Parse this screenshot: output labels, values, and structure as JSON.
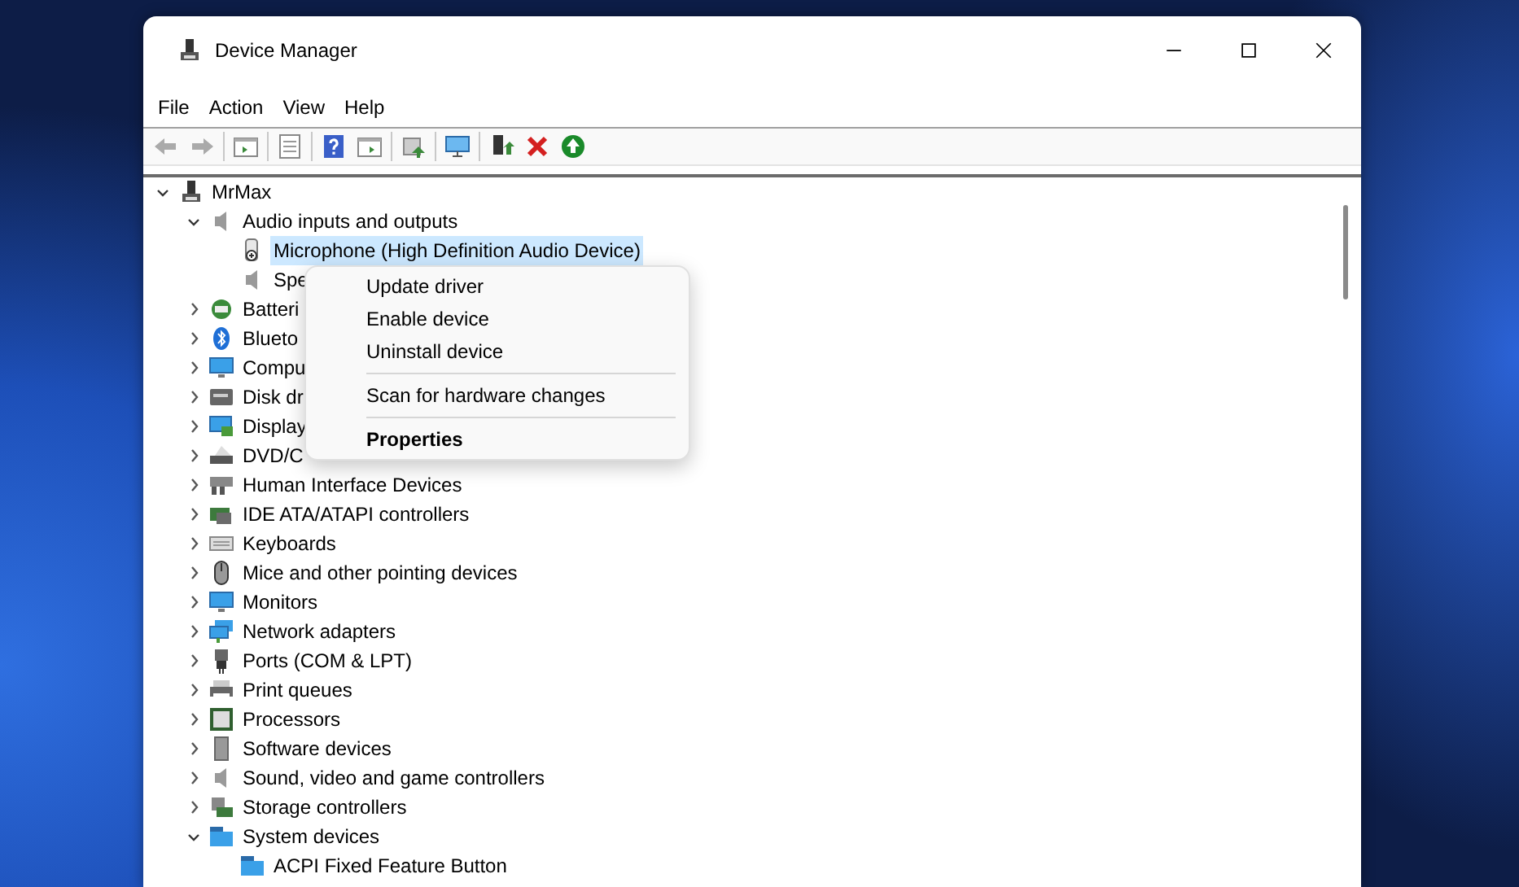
{
  "window": {
    "title": "Device Manager"
  },
  "menu_bar": [
    "File",
    "Action",
    "View",
    "Help"
  ],
  "tree": [
    {
      "label": "MrMax",
      "expanded": true,
      "selected": false,
      "children": [
        {
          "label": "Audio inputs and outputs",
          "expanded": true,
          "selected": false,
          "children": [
            {
              "label": "Microphone (High Definition Audio Device)",
              "selected": true
            },
            {
              "label": "Spe",
              "selected": false
            }
          ]
        },
        {
          "label": "Batteri",
          "expanded": false,
          "selected": false
        },
        {
          "label": "Blueto",
          "expanded": false,
          "selected": false
        },
        {
          "label": "Compu",
          "expanded": false,
          "selected": false
        },
        {
          "label": "Disk dr",
          "expanded": false,
          "selected": false
        },
        {
          "label": "Display",
          "expanded": false,
          "selected": false
        },
        {
          "label": "DVD/C",
          "expanded": false,
          "selected": false
        },
        {
          "label": "Human Interface Devices",
          "expanded": false,
          "selected": false
        },
        {
          "label": "IDE ATA/ATAPI controllers",
          "expanded": false,
          "selected": false
        },
        {
          "label": "Keyboards",
          "expanded": false,
          "selected": false
        },
        {
          "label": "Mice and other pointing devices",
          "expanded": false,
          "selected": false
        },
        {
          "label": "Monitors",
          "expanded": false,
          "selected": false
        },
        {
          "label": "Network adapters",
          "expanded": false,
          "selected": false
        },
        {
          "label": "Ports (COM & LPT)",
          "expanded": false,
          "selected": false
        },
        {
          "label": "Print queues",
          "expanded": false,
          "selected": false
        },
        {
          "label": "Processors",
          "expanded": false,
          "selected": false
        },
        {
          "label": "Software devices",
          "expanded": false,
          "selected": false
        },
        {
          "label": "Sound, video and game controllers",
          "expanded": false,
          "selected": false
        },
        {
          "label": "Storage controllers",
          "expanded": false,
          "selected": false
        },
        {
          "label": "System devices",
          "expanded": true,
          "selected": false,
          "children": [
            {
              "label": "ACPI Fixed Feature Button",
              "selected": false
            }
          ]
        }
      ]
    }
  ],
  "context_menu": [
    {
      "kind": "item",
      "label": "Update driver",
      "default": false
    },
    {
      "kind": "item",
      "label": "Enable device",
      "default": false
    },
    {
      "kind": "item",
      "label": "Uninstall device",
      "default": false
    },
    {
      "kind": "separator"
    },
    {
      "kind": "item",
      "label": "Scan for hardware changes",
      "default": false
    },
    {
      "kind": "separator"
    },
    {
      "kind": "item",
      "label": "Properties",
      "default": true
    }
  ]
}
